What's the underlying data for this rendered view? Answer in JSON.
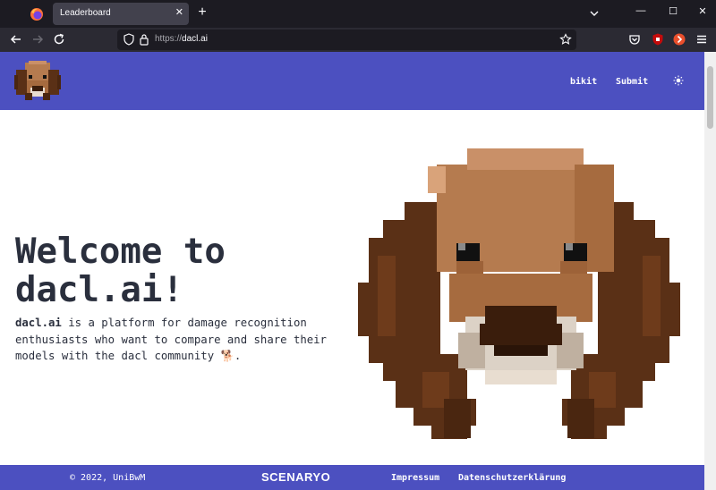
{
  "browser": {
    "tab_title": "Leaderboard",
    "tab_close": "✕",
    "new_tab": "+",
    "url_protocol": "https://",
    "url_host": "dacl.ai",
    "window_controls": {
      "minimize": "—",
      "maximize": "☐",
      "close": "✕"
    }
  },
  "header": {
    "nav": [
      "bikit",
      "Submit"
    ]
  },
  "hero": {
    "title": "Welcome to dacl.ai!",
    "text_bold": "dacl.ai",
    "text_rest": " is a platform for damage recognition enthusiasts who want to compare and share their models with the dacl community 🐕."
  },
  "footer": {
    "copyright": "© 2022, UniBwM",
    "brand": "SCENARYO",
    "links": [
      "Impressum",
      "Datenschutzerklärung"
    ]
  },
  "colors": {
    "brand": "#4c50c0",
    "text": "#2a2f3d",
    "chrome_dark": "#1c1b22",
    "chrome_toolbar": "#2b2a33"
  }
}
